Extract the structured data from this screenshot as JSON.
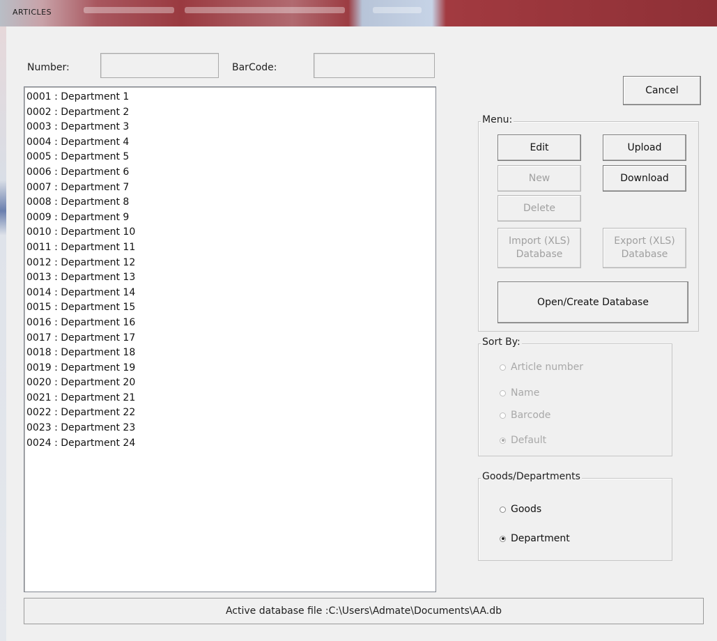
{
  "window": {
    "title": "ARTICLES"
  },
  "fields": {
    "number": {
      "label": "Number:",
      "value": ""
    },
    "barcode": {
      "label": "BarCode:",
      "value": ""
    }
  },
  "list": {
    "items": [
      "0001 : Department 1",
      "0002 : Department 2",
      "0003 : Department 3",
      "0004 : Department 4",
      "0005 : Department 5",
      "0006 : Department 6",
      "0007 : Department 7",
      "0008 : Department 8",
      "0009 : Department 9",
      "0010 : Department 10",
      "0011 : Department 11",
      "0012 : Department 12",
      "0013 : Department 13",
      "0014 : Department 14",
      "0015 : Department 15",
      "0016 : Department 16",
      "0017 : Department 17",
      "0018 : Department 18",
      "0019 : Department 19",
      "0020 : Department 20",
      "0021 : Department 21",
      "0022 : Department 22",
      "0023 : Department 23",
      "0024 : Department 24"
    ]
  },
  "buttons": {
    "cancel": "Cancel",
    "edit": "Edit",
    "upload": "Upload",
    "new": "New",
    "download": "Download",
    "delete": "Delete",
    "import_line1": "Import (XLS)",
    "import_line2": "Database",
    "export_line1": "Export (XLS)",
    "export_line2": "Database",
    "open_create": "Open/Create Database"
  },
  "menu": {
    "legend": "Menu:"
  },
  "sort": {
    "legend": "Sort By:",
    "options": [
      {
        "label": "Article number",
        "selected": false
      },
      {
        "label": "Name",
        "selected": false
      },
      {
        "label": "Barcode",
        "selected": false
      },
      {
        "label": "Default",
        "selected": true
      }
    ]
  },
  "goods": {
    "legend": "Goods/Departments",
    "options": [
      {
        "label": "Goods",
        "selected": false
      },
      {
        "label": "Department",
        "selected": true
      }
    ]
  },
  "status": {
    "text": "Active database file :C:\\Users\\Admate\\Documents\\AA.db"
  }
}
